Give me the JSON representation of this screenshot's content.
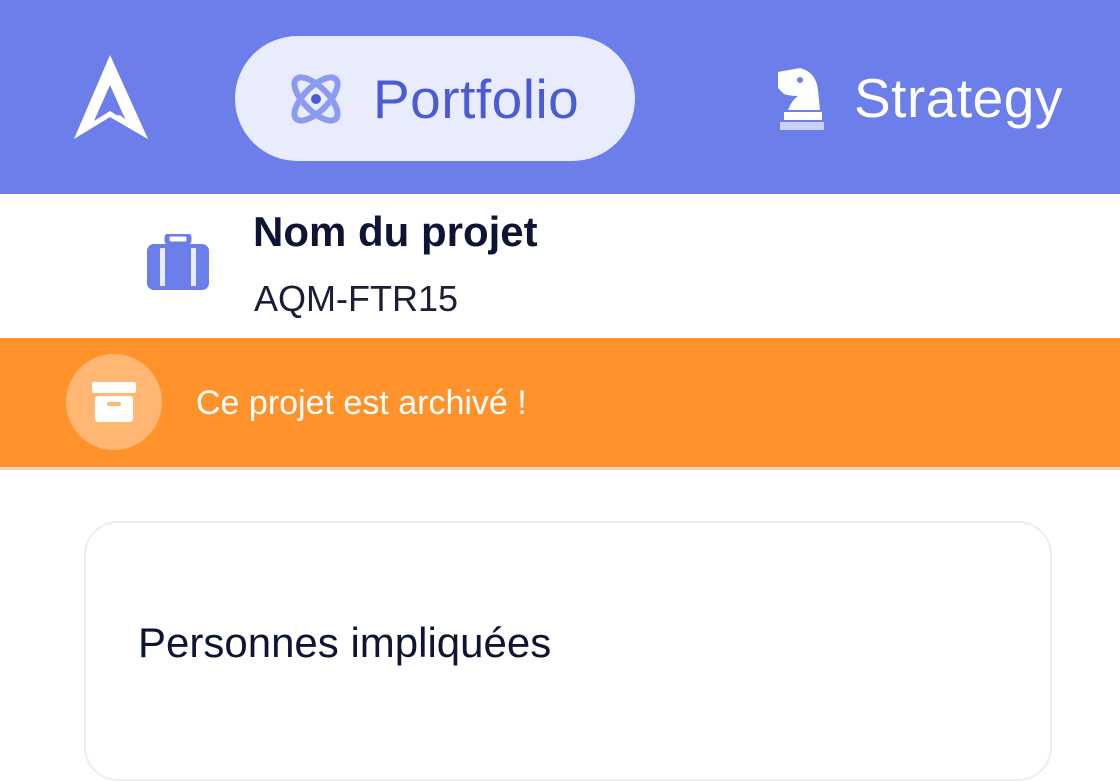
{
  "nav": {
    "logo": "app-logo",
    "tabs": [
      {
        "label": "Portfolio",
        "icon": "atom-icon",
        "active": true
      },
      {
        "label": "Strategy",
        "icon": "chess-knight-icon",
        "active": false
      }
    ]
  },
  "project": {
    "icon": "briefcase-icon",
    "title": "Nom du projet",
    "code": "AQM-FTR15"
  },
  "banner": {
    "icon": "archive-box-icon",
    "text": "Ce projet est archivé !"
  },
  "section": {
    "title": "Personnes impliquées"
  },
  "colors": {
    "nav_bg": "#6b7ee9",
    "active_tab_bg": "#e9ecfc",
    "active_tab_text": "#4a5bd6",
    "banner_bg": "#ff922b",
    "text_dark": "#0e1433"
  }
}
